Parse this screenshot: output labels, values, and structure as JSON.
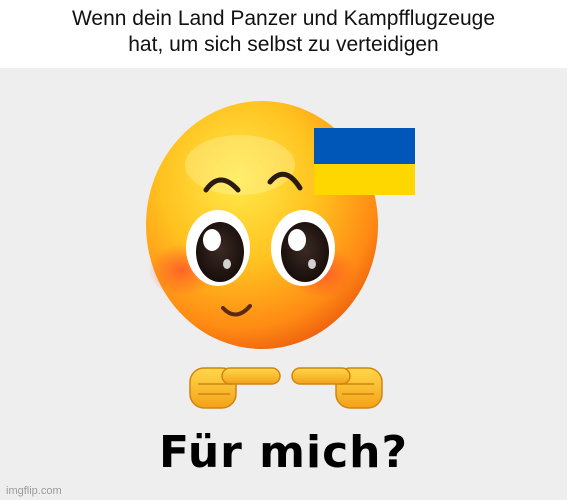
{
  "meme": {
    "top_caption_lines": [
      "Wenn dein Land Panzer und Kampfflugzeuge",
      "hat, um sich selbst zu verteidigen"
    ],
    "bottom_caption": "Für mich?",
    "watermark": "imgflip.com"
  },
  "flag": {
    "top_color": "#0057b7",
    "bottom_color": "#ffd700"
  },
  "emoji": {
    "icon": "shy-pleading-face-emoji",
    "face_color": "#f5a623"
  },
  "hands": {
    "icon": "index-pointing-hands-emoji"
  }
}
